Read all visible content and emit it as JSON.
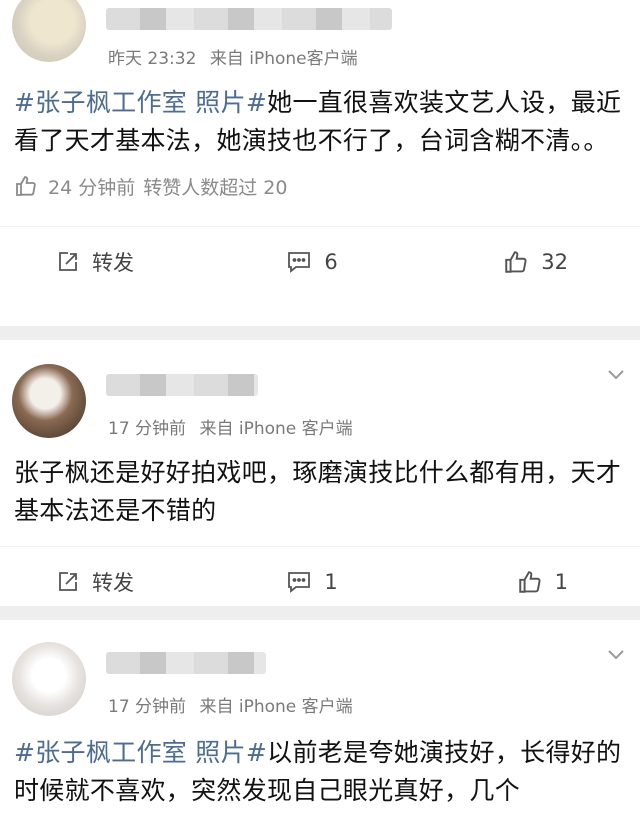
{
  "posts": [
    {
      "time": "昨天 23:32",
      "source": "来自 iPhone客户端",
      "tag": "#张子枫工作室 照片#",
      "text": "她一直很喜欢装文艺人设，最近看了天才基本法，她演技也不行了，台词含糊不清。。",
      "liked_time": "24 分钟前",
      "liked_text": "转赞人数超过 20",
      "repost_label": "转发",
      "comments": "6",
      "likes": "32"
    },
    {
      "time": "17 分钟前",
      "source": "来自 iPhone 客户端",
      "text": "张子枫还是好好拍戏吧，琢磨演技比什么都有用，天才基本法还是不错的",
      "repost_label": "转发",
      "comments": "1",
      "likes": "1"
    },
    {
      "time": "17 分钟前",
      "source": "来自 iPhone 客户端",
      "tag": "#张子枫工作室 照片#",
      "text": "以前老是夸她演技好，长得好的时候就不喜欢，突然发现自己眼光真好，几个"
    }
  ],
  "icons": {
    "repost": "share-edit-icon",
    "comment": "comment-icon",
    "like": "thumbs-up-icon",
    "menu": "chevron-down-icon"
  }
}
